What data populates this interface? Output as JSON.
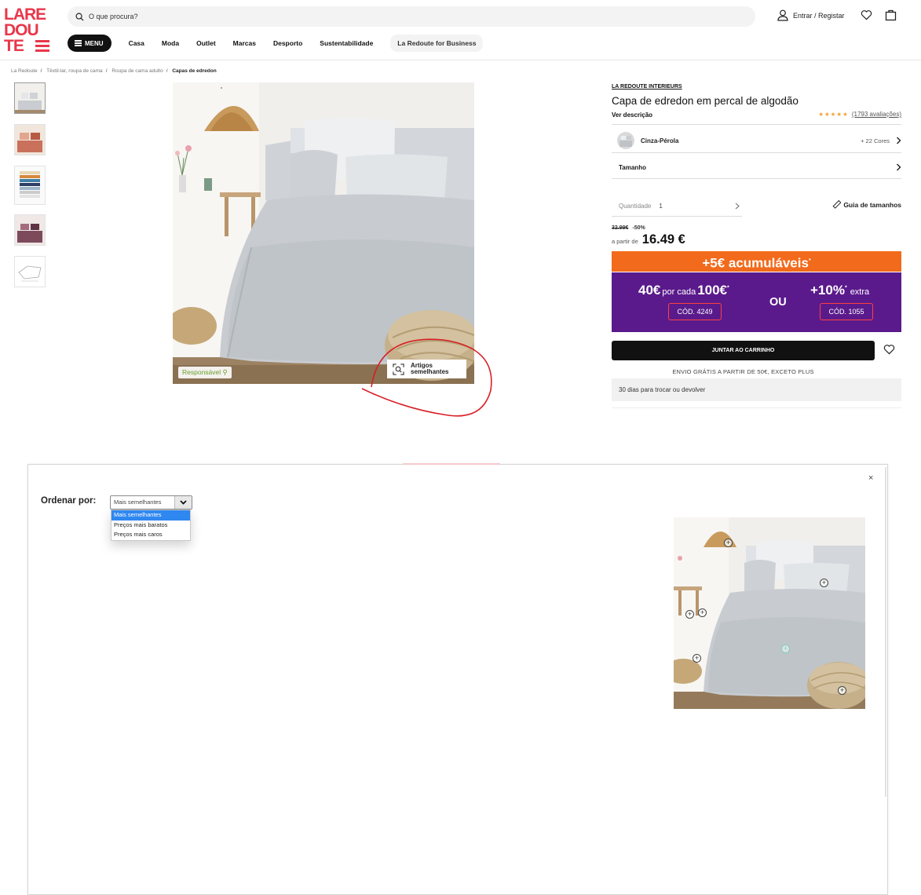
{
  "header": {
    "logo_lines": [
      "LARE",
      "DOU",
      "TE"
    ],
    "search_placeholder": "O que procura?",
    "account_label": "Entrar / Registar"
  },
  "nav": {
    "menu_label": "MENU",
    "items": [
      "Casa",
      "Moda",
      "Outlet",
      "Marcas",
      "Desporto",
      "Sustentabilidade"
    ],
    "business_label": "La Redoute for Business"
  },
  "breadcrumb": [
    "La Redoute",
    "Têxtil-lar, roupa de cama",
    "Roupa de cama adulto",
    "Capas de edredon"
  ],
  "gallery": {
    "responsible_badge": "Responsável",
    "similar_button": [
      "Artigos",
      "semelhantes"
    ]
  },
  "product": {
    "brand": "LA REDOUTE INTERIEURS",
    "title": "Capa de edredon em percal de algodão",
    "description_link": "Ver descrição",
    "rating_stars": "★★★★★",
    "reviews": "(1793 avaliações)",
    "color_name": "Cinza-Pérola",
    "more_colors": "+ 22 Cores",
    "size_label": "Tamanho",
    "quantity_label": "Quantidade",
    "quantity_value": "1",
    "size_guide": "Guia de tamanhos",
    "old_price": "32.99€",
    "discount": "-50%",
    "price_prefix": "a partir de",
    "price": "16.49 €",
    "add_to_cart": "JUNTAR AO CARRINHO",
    "shipping_note": "ENVIO GRÁTIS A PARTIR DE 50€, EXCETO PLUS",
    "returns_note": "30 dias para trocar ou devolver"
  },
  "promo": {
    "orange_text": "+5€ acumuláveis",
    "orange_mark": "*",
    "left_amount": "40€",
    "left_mid": "por cada",
    "left_threshold": "100€",
    "left_mark": "*",
    "code_left": "CÓD. 4249",
    "or": "OU",
    "right_amount": "+10%",
    "right_mark": "*",
    "right_suffix": "extra",
    "code_right": "CÓD. 1055"
  },
  "modal": {
    "sort_label": "Ordenar por:",
    "selected": "Mais semelhantes",
    "options": [
      "Mais semelhantes",
      "Preços mais baratos",
      "Preços mais caros"
    ],
    "close": "×"
  },
  "colors": {
    "brand_red": "#e8374a",
    "promo_orange": "#f26a1b",
    "promo_purple": "#5a1a8c",
    "select_highlight": "#2f87f0"
  }
}
